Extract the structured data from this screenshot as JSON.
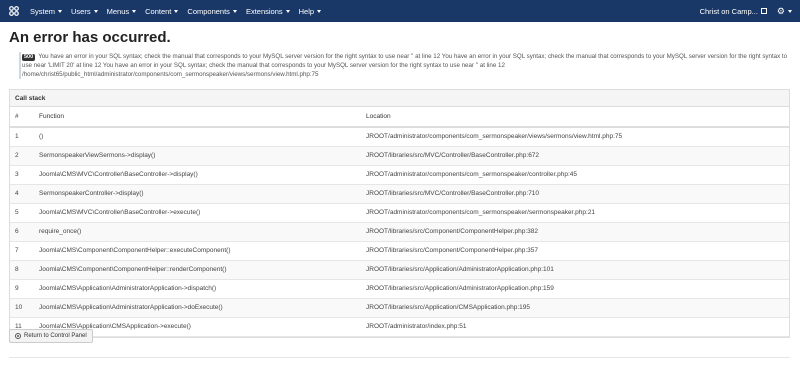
{
  "topbar": {
    "menu": [
      {
        "label": "System"
      },
      {
        "label": "Users"
      },
      {
        "label": "Menus"
      },
      {
        "label": "Content"
      },
      {
        "label": "Components"
      },
      {
        "label": "Extensions"
      },
      {
        "label": "Help"
      }
    ],
    "site_link": "Christ on Camp...",
    "colors": {
      "bar": "#1a3867"
    }
  },
  "page_title": "An error has occurred.",
  "error": {
    "code": "500",
    "message": "You have an error in your SQL syntax; check the manual that corresponds to your MySQL server version for the right syntax to use near '' at line 12 You have an error in your SQL syntax; check the manual that corresponds to your MySQL server version for the right syntax to use near 'LIMIT 20' at line 12 You have an error in your SQL syntax; check the manual that corresponds to your MySQL server version for the right syntax to use near '' at line 12",
    "path": "/home/christ65/public_html/administrator/components/com_sermonspeaker/views/sermons/view.html.php:75"
  },
  "call_stack": {
    "title": "Call stack",
    "columns": [
      "#",
      "Function",
      "Location"
    ],
    "rows": [
      {
        "num": "1",
        "function": "()",
        "location": "JROOT/administrator/components/com_sermonspeaker/views/sermons/view.html.php:75"
      },
      {
        "num": "2",
        "function": "SermonspeakerViewSermons->display()",
        "location": "JROOT/libraries/src/MVC/Controller/BaseController.php:672"
      },
      {
        "num": "3",
        "function": "Joomla\\CMS\\MVC\\Controller\\BaseController->display()",
        "location": "JROOT/administrator/components/com_sermonspeaker/controller.php:45"
      },
      {
        "num": "4",
        "function": "SermonspeakerController->display()",
        "location": "JROOT/libraries/src/MVC/Controller/BaseController.php:710"
      },
      {
        "num": "5",
        "function": "Joomla\\CMS\\MVC\\Controller\\BaseController->execute()",
        "location": "JROOT/administrator/components/com_sermonspeaker/sermonspeaker.php:21"
      },
      {
        "num": "6",
        "function": "require_once()",
        "location": "JROOT/libraries/src/Component/ComponentHelper.php:382"
      },
      {
        "num": "7",
        "function": "Joomla\\CMS\\Component\\ComponentHelper::executeComponent()",
        "location": "JROOT/libraries/src/Component/ComponentHelper.php:357"
      },
      {
        "num": "8",
        "function": "Joomla\\CMS\\Component\\ComponentHelper::renderComponent()",
        "location": "JROOT/libraries/src/Application/AdministratorApplication.php:101"
      },
      {
        "num": "9",
        "function": "Joomla\\CMS\\Application\\AdministratorApplication->dispatch()",
        "location": "JROOT/libraries/src/Application/AdministratorApplication.php:159"
      },
      {
        "num": "10",
        "function": "Joomla\\CMS\\Application\\AdministratorApplication->doExecute()",
        "location": "JROOT/libraries/src/Application/CMSApplication.php:195"
      },
      {
        "num": "11",
        "function": "Joomla\\CMS\\Application\\CMSApplication->execute()",
        "location": "JROOT/administrator/index.php:51"
      }
    ]
  },
  "return_button": "Return to Control Panel"
}
